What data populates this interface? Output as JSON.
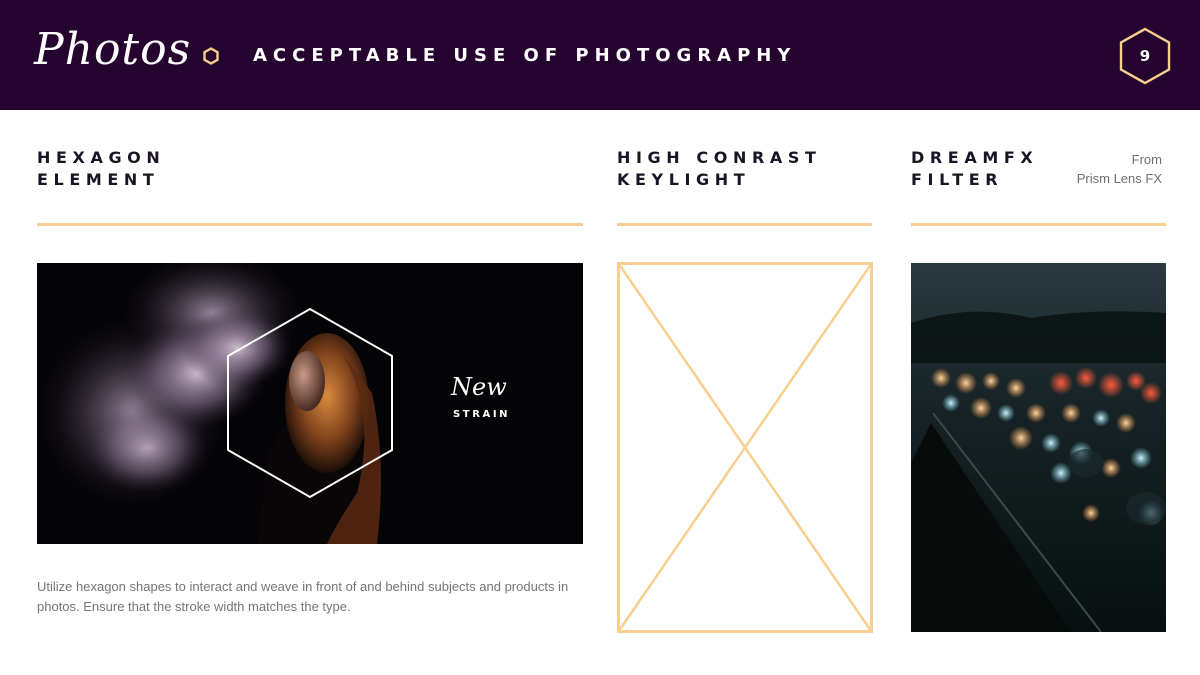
{
  "header": {
    "brand": "Photos",
    "title": "ACCEPTABLE USE OF PHOTOGRAPHY",
    "page_number": "9",
    "accent_color": "#f7cf8f",
    "background_color": "#25042f"
  },
  "columns": [
    {
      "heading_line1": "HEXAGON",
      "heading_line2": "ELEMENT",
      "image": {
        "script_text": "New",
        "caption": "STRAIN"
      },
      "description": "Utilize hexagon shapes to interact and weave in front of and behind subjects and products in photos.  Ensure that the stroke width matches the type."
    },
    {
      "heading_line1": "HIGH CONRAST",
      "heading_line2": "KEYLIGHT"
    },
    {
      "heading_line1": "DREAMFX",
      "heading_line2": "FILTER",
      "credit_line1": "From",
      "credit_line2": "Prism Lens FX"
    }
  ]
}
